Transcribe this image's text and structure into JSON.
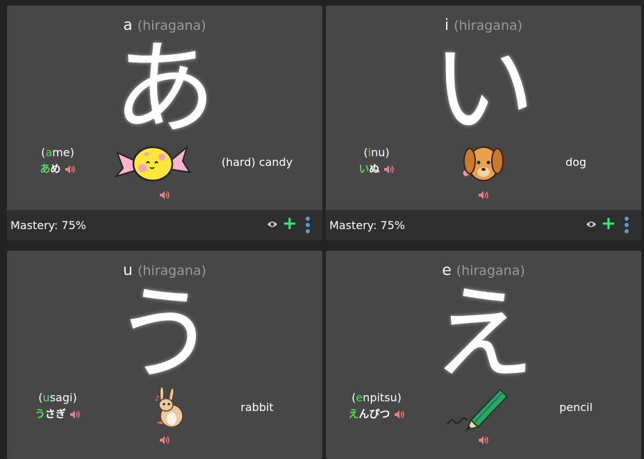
{
  "cards": [
    {
      "romaji": "a",
      "script": "(hiragana)",
      "glyph": "あ",
      "word_open": "(",
      "word_hl": "a",
      "word_rest": "me",
      "word_close": ")",
      "kana_hl": "あ",
      "kana_rest": "め",
      "meaning": "(hard) candy",
      "picture": "candy-icon",
      "mastery": "Mastery: 75%"
    },
    {
      "romaji": "i",
      "script": "(hiragana)",
      "glyph": "い",
      "word_open": "(",
      "word_hl": "i",
      "word_rest": "nu",
      "word_close": ")",
      "kana_hl": "い",
      "kana_rest": "ぬ",
      "meaning": "dog",
      "picture": "dog-icon",
      "mastery": "Mastery: 75%"
    },
    {
      "romaji": "u",
      "script": "(hiragana)",
      "glyph": "う",
      "word_open": "(",
      "word_hl": "u",
      "word_rest": "sagi",
      "word_close": ")",
      "kana_hl": "う",
      "kana_rest": "さぎ",
      "meaning": "rabbit",
      "picture": "rabbit-icon"
    },
    {
      "romaji": "e",
      "script": "(hiragana)",
      "glyph": "え",
      "word_open": "(",
      "word_hl": "e",
      "word_rest": "npitsu",
      "word_close": ")",
      "kana_hl": "え",
      "kana_rest": "んぴつ",
      "meaning": "pencil",
      "picture": "pencil-icon"
    }
  ],
  "colors": {
    "highlight": "#55dd55",
    "speaker": "#f08080",
    "plus": "#33ee77",
    "kebab": "#5b9bd5"
  }
}
